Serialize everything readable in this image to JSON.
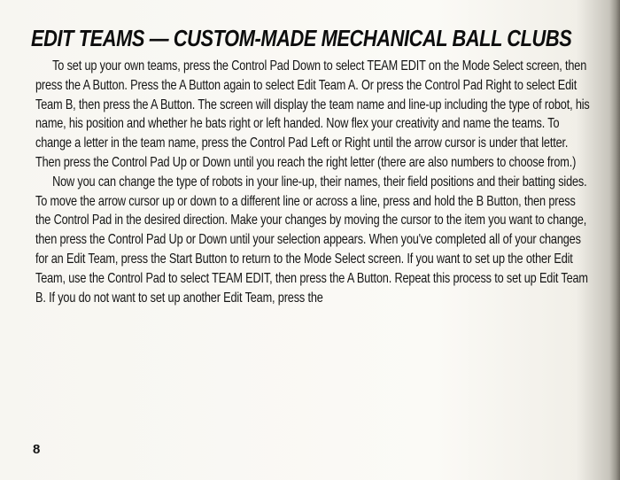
{
  "heading": "EDIT TEAMS — CUSTOM-MADE MECHANICAL BALL CLUBS",
  "paragraphs": [
    "To set up your own teams, press the Control Pad Down to select TEAM EDIT on the Mode Select screen, then press the A Button. Press the A Button again to select Edit Team A. Or press the Control Pad Right to select Edit Team B, then press the A Button. The screen will display the team name and line-up including the type of robot, his name, his position and whether he bats right or left handed. Now flex your creativity and name the teams. To change a letter in the team name, press the Control Pad Left or Right until the arrow cursor is under that letter. Then press the Control Pad Up or Down until you reach the right letter (there are also numbers to choose from.)",
    "Now you can change the type of robots in your line-up, their names, their field positions and their batting sides. To move the arrow cursor up or down to a different line or across a line, press and hold the B Button, then press the Control Pad in the desired direction. Make your changes by moving the cursor to the item you want to change, then press the Control Pad Up or Down until your selection appears. When you've completed all of your changes for an Edit Team, press the Start Button to return to the Mode Select screen. If you want to set up the other Edit Team, use the Control Pad to select TEAM EDIT, then press the A Button. Repeat this process to set up Edit Team B. If you do not want to set up another Edit Team, press the"
  ],
  "page_number": "8"
}
